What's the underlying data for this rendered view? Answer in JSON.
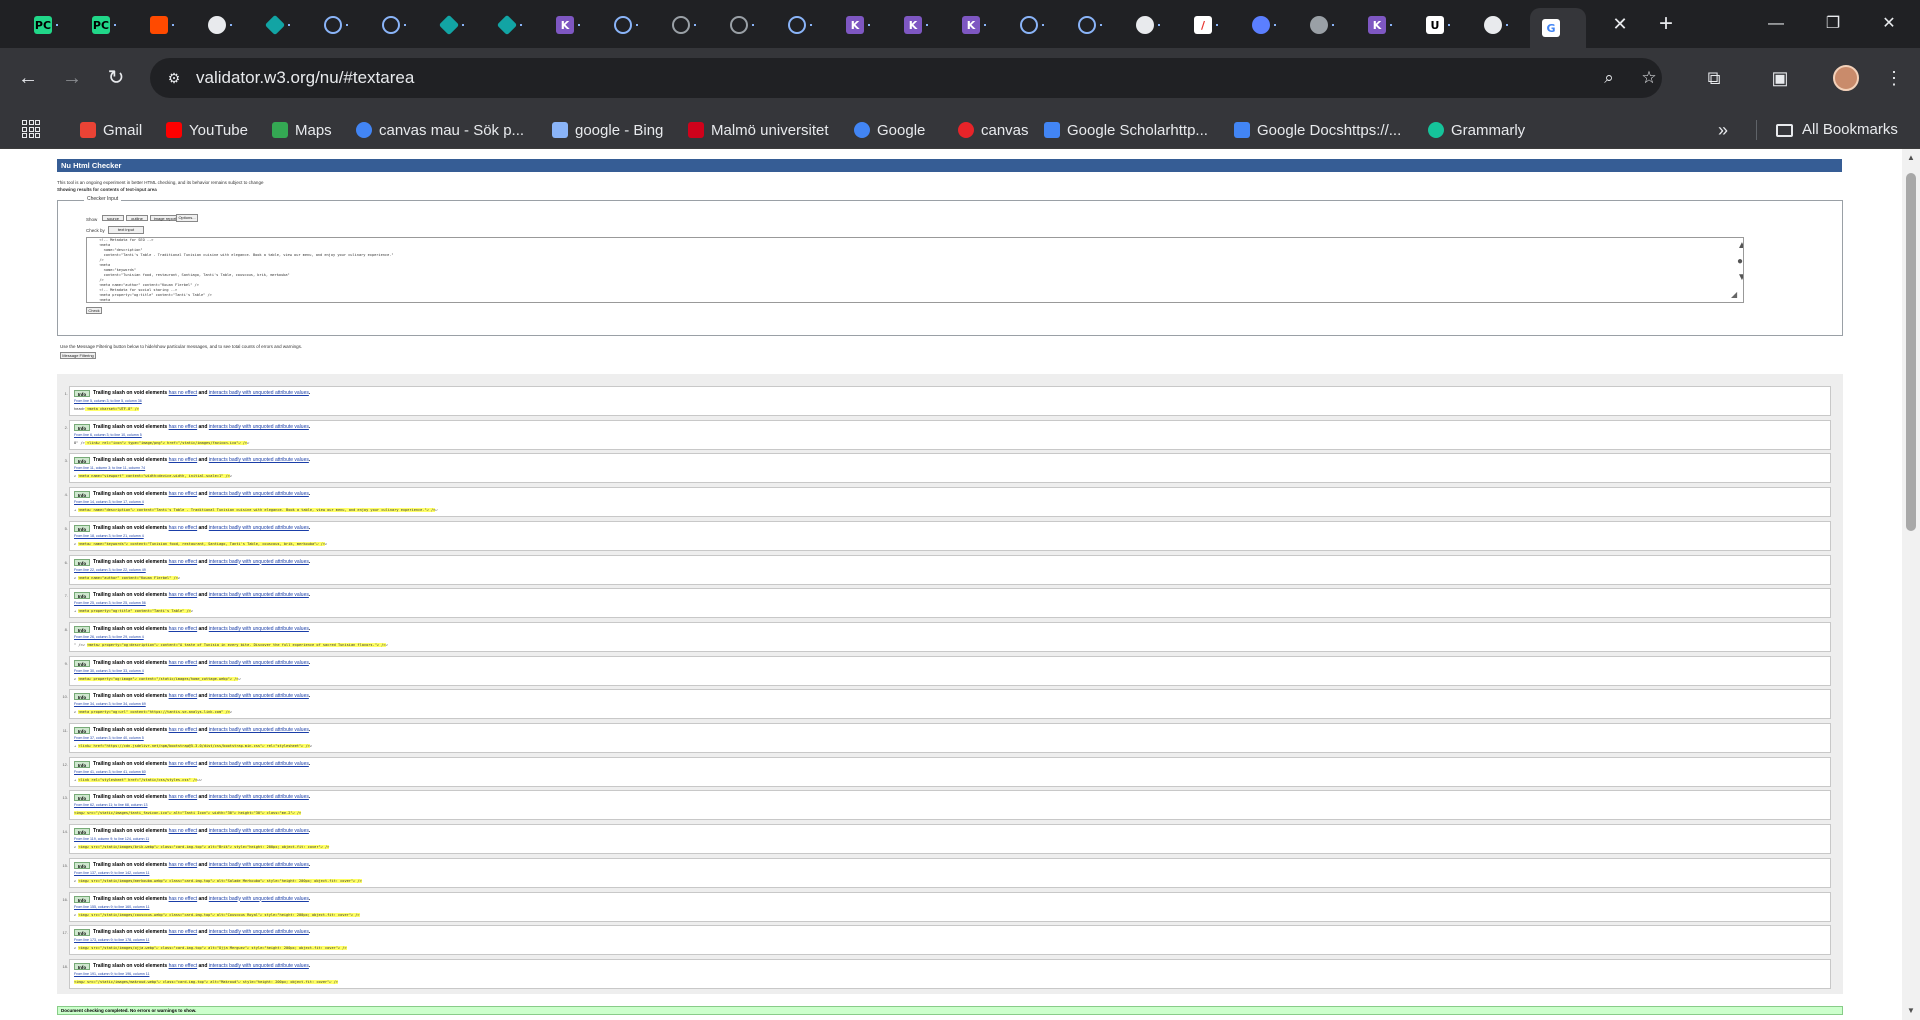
{
  "browser": {
    "tabs": [
      {
        "icon": "pycharm-icon",
        "color": "#21d789",
        "label": "PC"
      },
      {
        "icon": "pycharm-icon",
        "color": "#21d789",
        "label": "PC"
      },
      {
        "icon": "recording-icon",
        "color": "#ff4a00",
        "label": ""
      },
      {
        "icon": "chatgpt-icon",
        "color": "#e8eaed",
        "label": ""
      },
      {
        "icon": "diamond-icon",
        "color": "#12a4a4",
        "label": ""
      },
      {
        "icon": "loading-icon",
        "color": "#8ab4f8",
        "label": ""
      },
      {
        "icon": "loading-icon",
        "color": "#8ab4f8",
        "label": ""
      },
      {
        "icon": "diamond-icon",
        "color": "#12a4a4",
        "label": ""
      },
      {
        "icon": "diamond-icon",
        "color": "#12a4a4",
        "label": ""
      },
      {
        "icon": "k-icon",
        "color": "#7e57c2",
        "label": "K"
      },
      {
        "icon": "loading-icon",
        "color": "#8ab4f8",
        "label": ""
      },
      {
        "icon": "globe-icon",
        "color": "#9aa0a6",
        "label": ""
      },
      {
        "icon": "globe-icon",
        "color": "#9aa0a6",
        "label": ""
      },
      {
        "icon": "loading-icon",
        "color": "#8ab4f8",
        "label": ""
      },
      {
        "icon": "k-icon",
        "color": "#7e57c2",
        "label": "K"
      },
      {
        "icon": "k-icon",
        "color": "#7e57c2",
        "label": "K"
      },
      {
        "icon": "k-icon",
        "color": "#7e57c2",
        "label": "K"
      },
      {
        "icon": "loading-icon",
        "color": "#8ab4f8",
        "label": ""
      },
      {
        "icon": "loading-icon",
        "color": "#8ab4f8",
        "label": ""
      },
      {
        "icon": "github-icon",
        "color": "#e8eaed",
        "label": ""
      },
      {
        "icon": "slash-icon",
        "color": "#e8332c",
        "label": "/"
      },
      {
        "icon": "sync-icon",
        "color": "#5b7fff",
        "label": ""
      },
      {
        "icon": "chrome-icon",
        "color": "#9aa0a6",
        "label": ""
      },
      {
        "icon": "k-icon",
        "color": "#7e57c2",
        "label": "K"
      },
      {
        "icon": "u-icon",
        "color": "#000000",
        "label": "U"
      },
      {
        "icon": "chatgpt-icon",
        "color": "#e8eaed",
        "label": ""
      },
      {
        "icon": "google-icon",
        "color": "#4285f4",
        "label": "G"
      }
    ],
    "url": "validator.w3.org/nu/#textarea",
    "bookmarks": [
      {
        "label": "Gmail",
        "icon": "gmail-icon",
        "color": "#ea4335"
      },
      {
        "label": "YouTube",
        "icon": "youtube-icon",
        "color": "#ff0000"
      },
      {
        "label": "Maps",
        "icon": "maps-icon",
        "color": "#34a853"
      },
      {
        "label": "canvas mau - Sök p...",
        "icon": "google-icon",
        "color": "#4285f4"
      },
      {
        "label": "google - Bing",
        "icon": "search-icon",
        "color": "#8ab4f8"
      },
      {
        "label": "Malmö universitet",
        "icon": "mau-icon",
        "color": "#d0021b"
      },
      {
        "label": "Google",
        "icon": "google-icon",
        "color": "#4285f4"
      },
      {
        "label": "canvas",
        "icon": "canvas-icon",
        "color": "#e72429"
      },
      {
        "label": "Google Scholarhttp...",
        "icon": "scholar-icon",
        "color": "#4285f4"
      },
      {
        "label": "Google Docshttps://...",
        "icon": "docs-icon",
        "color": "#4285f4"
      },
      {
        "label": "Grammarly",
        "icon": "grammarly-icon",
        "color": "#15c39a"
      }
    ],
    "all_bookmarks": "All Bookmarks",
    "more": "»"
  },
  "page": {
    "title": "Nu Html Checker",
    "intro": "This tool is an ongoing experiment in better HTML checking, and its behavior remains subject to change",
    "showing": "Showing results for contents of text-input area",
    "legend": "Checker Input",
    "show_label": "Show",
    "show_options": [
      "source",
      "outline",
      "image report"
    ],
    "options_button": "Options...",
    "check_by_label": "Check by",
    "check_by_value": "text input",
    "check_button": "Check",
    "filter_note": "Use the Message Filtering button below to hide/show particular messages, and to see total counts of errors and warnings.",
    "filter_button": "Message Filtering",
    "textarea_lines": [
      "  <!-- Metadata for SEO -->",
      "  <meta",
      "    name=\"description\"",
      "    content=\"Tanti's Table - Traditional Tunisian cuisine with elegance. Book a table, view our menu, and enjoy your culinary experience.\"",
      "  />",
      "  <meta",
      "    name=\"keywords\"",
      "    content=\"Tunisian food, restaurant, Santiago, Tanti's Table, couscous, brik, merkouba\"",
      "  />",
      "  <meta name=\"author\" content=\"Kouan Flerbel\" />",
      "",
      "  <!-- Metadata for social sharing -->",
      "  <meta property=\"og:title\" content=\"Tanti's Table\" />",
      "  <meta",
      "    property=\"og:description\"",
      "    content=\"A taste of Tunisia in every bite. Discover the full experience of sacred Tunisian flavors.\""
    ],
    "success": "Document checking completed. No errors or warnings to show."
  },
  "messages": [
    {
      "num": "1.",
      "badge": "Info",
      "lead": "Trailing slash on void elements",
      "link1": "has no effect",
      "mid": "and",
      "link2": "interacts badly with unquoted attribute values",
      "end": ".",
      "loc": "From line 5, column 3; to line 5, column 36",
      "ext_pre": "head>",
      "ext_mark": "  <meta charset=\"UTF-8\" />",
      "ext_post": "  "
    },
    {
      "num": "2.",
      "badge": "Info",
      "lead": "Trailing slash on void elements",
      "link1": "has no effect",
      "mid": "and",
      "link2": "interacts badly with unquoted attribute values",
      "end": ".",
      "loc": "From line 6, column 3; to line 10, column 5",
      "ext_pre": "8\" />",
      "ext_mark": "  <link↩    rel=\"icon\"↩    type=\"image/png\"↩    href=\"/static/images/favicon.ico\"↩  />",
      "ext_post": "↩"
    },
    {
      "num": "3.",
      "badge": "Info",
      "lead": "Trailing slash on void elements",
      "link1": "has no effect",
      "mid": "and",
      "link2": "interacts badly with unquoted attribute values",
      "end": ".",
      "loc": "From line 11, column 3; to line 11, column 74",
      "ext_pre": "↩  ",
      "ext_mark": "<meta name=\"viewport\" content=\"width=device-width, initial-scale=1\" />",
      "ext_post": "↩"
    },
    {
      "num": "4.",
      "badge": "Info",
      "lead": "Trailing slash on void elements",
      "link1": "has no effect",
      "mid": "and",
      "link2": "interacts badly with unquoted attribute values",
      "end": ".",
      "loc": "From line 14, column 3; to line 17, column 4",
      "ext_pre": "→   ",
      "ext_mark": "<meta↩    name=\"description\"↩    content=\"Tanti's Table - Traditional Tunisian cuisine with elegance. Book a table, view our menu, and enjoy your culinary experience.\"↩  />",
      "ext_post": "↩"
    },
    {
      "num": "5.",
      "badge": "Info",
      "lead": "Trailing slash on void elements",
      "link1": "has no effect",
      "mid": "and",
      "link2": "interacts badly with unquoted attribute values",
      "end": ".",
      "loc": "From line 18, column 3; to line 21, column 4",
      "ext_pre": "↩  ",
      "ext_mark": "<meta↩    name=\"keywords\"↩    content=\"Tunisian food, restaurant, Santiago, Tanti's Table, couscous, brik, merkouba\"↩  />",
      "ext_post": "↩"
    },
    {
      "num": "6.",
      "badge": "Info",
      "lead": "Trailing slash on void elements",
      "link1": "has no effect",
      "mid": "and",
      "link2": "interacts badly with unquoted attribute values",
      "end": ".",
      "loc": "From line 22, column 3; to line 22, column 49",
      "ext_pre": "↩  ",
      "ext_mark": "<meta name=\"author\" content=\"Kouan Flerbel\" />",
      "ext_post": "↩"
    },
    {
      "num": "7.",
      "badge": "Info",
      "lead": "Trailing slash on void elements",
      "link1": "has no effect",
      "mid": "and",
      "link2": "interacts badly with unquoted attribute values",
      "end": ".",
      "loc": "From line 25, column 3; to line 25, column 56",
      "ext_pre": "→   ",
      "ext_mark": "<meta property=\"og:title\" content=\"Tanti's Table\" />",
      "ext_post": "↩"
    },
    {
      "num": "8.",
      "badge": "Info",
      "lead": "Trailing slash on void elements",
      "link1": "has no effect",
      "mid": "and",
      "link2": "interacts badly with unquoted attribute values",
      "end": ".",
      "loc": "From line 26, column 3; to line 29, column 4",
      "ext_pre": "\" />↩  ",
      "ext_mark": "<meta↩    property=\"og:description\"↩    content=\"A taste of Tunisia in every bite. Discover the full experience of sacred Tunisian flavors.\"↩  />",
      "ext_post": "↩"
    },
    {
      "num": "9.",
      "badge": "Info",
      "lead": "Trailing slash on void elements",
      "link1": "has no effect",
      "mid": "and",
      "link2": "interacts badly with unquoted attribute values",
      "end": ".",
      "loc": "From line 30, column 3; to line 33, column 4",
      "ext_pre": "↩  ",
      "ext_mark": "<meta↩    property=\"og:image\"↩    content=\"/static/images/home_cottage.webp\"↩  />",
      "ext_post": "↩"
    },
    {
      "num": "10.",
      "badge": "Info",
      "lead": "Trailing slash on void elements",
      "link1": "has no effect",
      "mid": "and",
      "link2": "interacts badly with unquoted attribute values",
      "end": ".",
      "loc": "From line 34, column 3; to line 34, column 69",
      "ext_pre": "↩  ",
      "ext_mark": "<meta property=\"og:url\" content=\"https://tantis.se-analys-link.com\" />",
      "ext_post": "↩"
    },
    {
      "num": "11.",
      "badge": "Info",
      "lead": "Trailing slash on void elements",
      "link1": "has no effect",
      "mid": "and",
      "link2": "interacts badly with unquoted attribute values",
      "end": ".",
      "loc": "From line 37, column 3; to line 40, column 5",
      "ext_pre": "→   ",
      "ext_mark": "<link↩    href=\"https://cdn.jsdelivr.net/npm/bootstrap@5.3.0/dist/css/bootstrap.min.css\"↩    rel=\"stylesheet\"↩  />",
      "ext_post": "↩"
    },
    {
      "num": "12.",
      "badge": "Info",
      "lead": "Trailing slash on void elements",
      "link1": "has no effect",
      "mid": "and",
      "link2": "interacts badly with unquoted attribute values",
      "end": ".",
      "loc": "From line 41, column 3; to line 41, column 60",
      "ext_pre": "→   ",
      "ext_mark": "<link rel=\"stylesheet\" href=\"/static/css/styles.css\" />",
      "ext_post": "↩↩"
    },
    {
      "num": "13.",
      "badge": "Info",
      "lead": "Trailing slash on void elements",
      "link1": "has no effect",
      "mid": "and",
      "link2": "interacts badly with unquoted attribute values",
      "end": ".",
      "loc": "From line 62, column 11; to line 68, column 13",
      "ext_pre": "        ",
      "ext_mark": "<img↩          src=\"/static/images/tanti_favicon.ico\"↩          alt=\"Tanti Icon\"↩          width=\"30\"↩          height=\"30\"↩          class=\"me-2\"↩        />",
      "ext_post": ""
    },
    {
      "num": "14.",
      "badge": "Info",
      "lead": "Trailing slash on void elements",
      "link1": "has no effect",
      "mid": "and",
      "link2": "interacts badly with unquoted attribute values",
      "end": ".",
      "loc": "From line 119, column 9; to line 124, column 11",
      "ext_pre": "↩  ",
      "ext_mark": "<img↩          src=\"/static/images/brik.webp\"↩          class=\"card-img-top\"↩          alt=\"Brik\"↩          style=\"height: 200px; object-fit: cover\"↩        />",
      "ext_post": ""
    },
    {
      "num": "15.",
      "badge": "Info",
      "lead": "Trailing slash on void elements",
      "link1": "has no effect",
      "mid": "and",
      "link2": "interacts badly with unquoted attribute values",
      "end": ".",
      "loc": "From line 137, column 9; to line 142, column 11",
      "ext_pre": "↩  ",
      "ext_mark": "<img↩          src=\"/static/images/merkouba.webp\"↩          class=\"card-img-top\"↩          alt=\"Salade Merkouba\"↩          style=\"height: 200px; object-fit: cover\"↩        />",
      "ext_post": ""
    },
    {
      "num": "16.",
      "badge": "Info",
      "lead": "Trailing slash on void elements",
      "link1": "has no effect",
      "mid": "and",
      "link2": "interacts badly with unquoted attribute values",
      "end": ".",
      "loc": "From line 155, column 9; to line 160, column 11",
      "ext_pre": "↩  ",
      "ext_mark": "<img↩          src=\"/static/images/couscous.webp\"↩          class=\"card-img-top\"↩          alt=\"Couscous Royal\"↩          style=\"height: 200px; object-fit: cover\"↩        />",
      "ext_post": ""
    },
    {
      "num": "17.",
      "badge": "Info",
      "lead": "Trailing slash on void elements",
      "link1": "has no effect",
      "mid": "and",
      "link2": "interacts badly with unquoted attribute values",
      "end": ".",
      "loc": "From line 173, column 9; to line 178, column 11",
      "ext_pre": "↩  ",
      "ext_mark": "<img↩          src=\"/static/images/ojja.webp\"↩          class=\"card-img-top\"↩          alt=\"Ojja Merguez\"↩          style=\"height: 200px; object-fit: cover\"↩        />",
      "ext_post": ""
    },
    {
      "num": "18.",
      "badge": "Info",
      "lead": "Trailing slash on void elements",
      "link1": "has no effect",
      "mid": "and",
      "link2": "interacts badly with unquoted attribute values",
      "end": ".",
      "loc": "From line 191, column 9; to line 196, column 11",
      "ext_pre": "        ",
      "ext_mark": "<img↩          src=\"/static/images/makroud.webp\"↩          class=\"card-img-top\"↩          alt=\"Makroud\"↩          style=\"height: 200px; object-fit: cover\"↩        />",
      "ext_post": ""
    }
  ]
}
